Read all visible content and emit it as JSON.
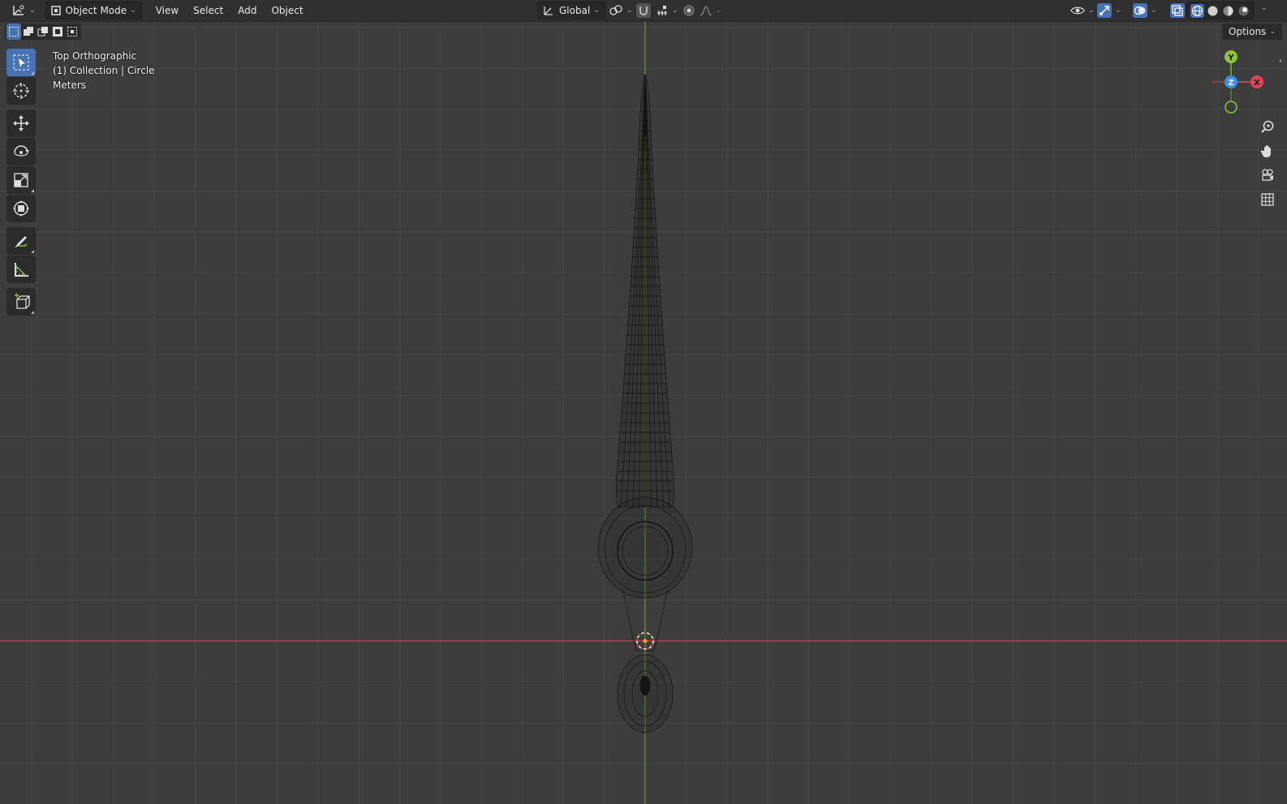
{
  "header": {
    "editor_type_icon": "viewport-editor-icon",
    "mode": "Object Mode",
    "menus": [
      "View",
      "Select",
      "Add",
      "Object"
    ],
    "orientation": "Global"
  },
  "overlay": {
    "view_name": "Top Orthographic",
    "collection_info": "(1) Collection | Circle",
    "units": "Meters"
  },
  "options_label": "Options",
  "gizmo": {
    "x": "X",
    "y": "Y",
    "z": "Z"
  },
  "colors": {
    "background": "#3d3d3d",
    "grid_line": "#464646",
    "axis_x": "#c04452",
    "axis_y": "#6a9a23",
    "active_tool": "#4772b3",
    "gizmo_x": "#e04455",
    "gizmo_y": "#8bc33a",
    "gizmo_z": "#3b8fe8"
  },
  "tools": [
    "select-box-icon",
    "cursor-icon",
    "move-icon",
    "rotate-icon",
    "scale-icon",
    "transform-icon",
    "annotate-icon",
    "measure-icon",
    "add-cube-icon"
  ]
}
